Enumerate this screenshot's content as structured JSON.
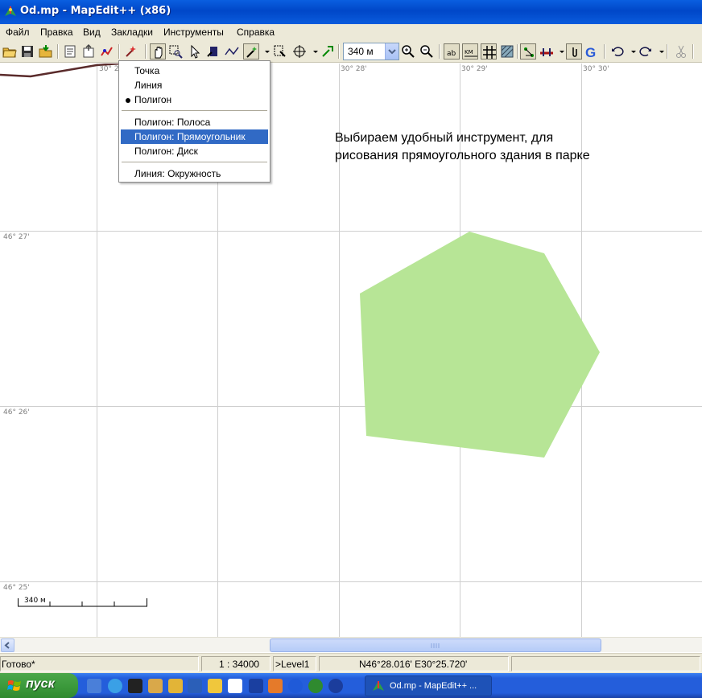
{
  "window": {
    "title": "Od.mp - MapEdit++ (x86)",
    "icon": "mapedit-app-icon"
  },
  "menubar": {
    "items": [
      "Файл",
      "Правка",
      "Вид",
      "Закладки",
      "Инструменты",
      "Справка"
    ]
  },
  "toolbar": {
    "scale_value": "340 м",
    "icons": [
      "open-icon",
      "save-icon",
      "import-icon",
      "properties-icon",
      "export-icon",
      "generalize-icon",
      "wand-icon",
      "hand-icon",
      "zoom-rect-icon",
      "select-icon",
      "edit-node-icon",
      "polyline-icon",
      "create-object-icon",
      "trim-icon",
      "rotate-icon",
      "connect-icon",
      "zoom-in-icon",
      "zoom-out-icon",
      "labels-icon",
      "km-icon",
      "grid-icon",
      "hatch-icon",
      "snap-icon",
      "ruler-icon",
      "attach-icon",
      "google-icon",
      "undo-icon",
      "redo-icon",
      "cut-icon"
    ]
  },
  "dropdown": {
    "items": [
      "Точка",
      "Линия",
      "Полигон",
      "Полигон: Полоса",
      "Полигон: Прямоугольник",
      "Полигон: Диск",
      "Линия: Окружность"
    ],
    "checked_item": "Полигон",
    "highlighted_item": "Полигон: Прямоугольник"
  },
  "map": {
    "lon_labels": [
      "30° 26'",
      "30° 28'",
      "30° 29'",
      "30° 30'"
    ],
    "lat_labels": [
      "46° 27'",
      "46° 26'",
      "46° 25'"
    ],
    "annotation": [
      "Выбираем удобный инструмент, для",
      "рисования прямоугольного здания в парке"
    ],
    "polygon_fill": "#b7e596",
    "road_color": "#5a2b2b",
    "scalebar_label": "340 м"
  },
  "statusbar": {
    "state": "Готово*",
    "scale": "1 : 34000",
    "level": ">Level1",
    "coords": "N46°28.016' E30°25.720'"
  },
  "taskbar": {
    "start_label": "пуск",
    "task_label": "Od.mp - MapEdit++ ..."
  }
}
